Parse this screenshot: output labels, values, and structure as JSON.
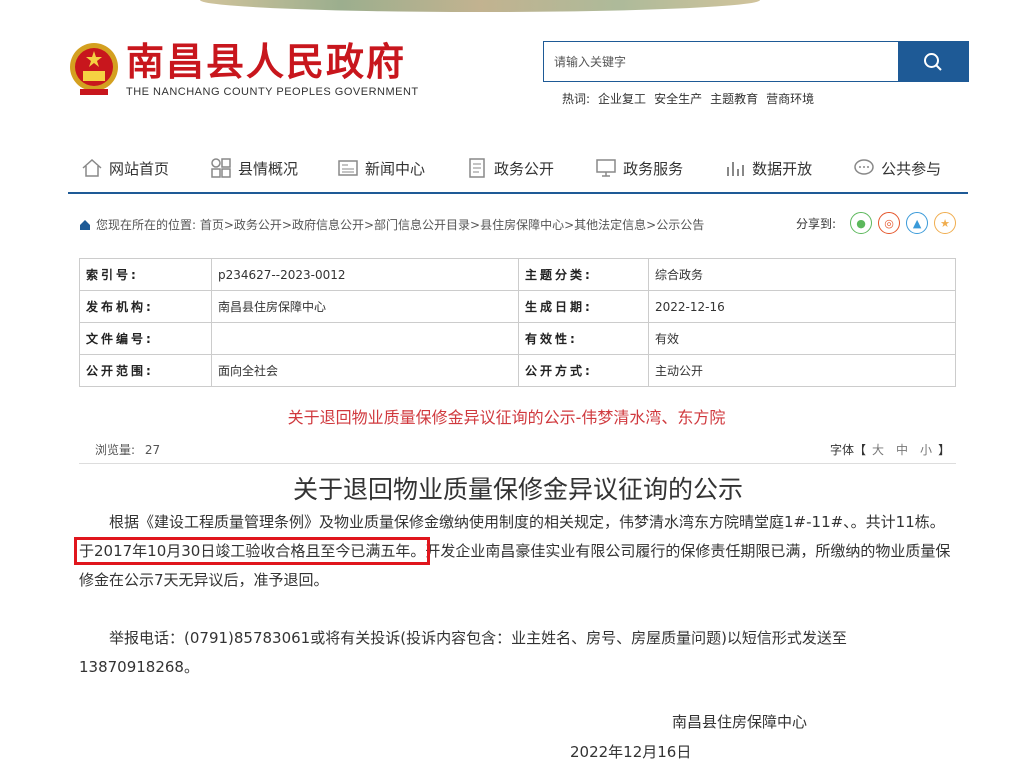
{
  "header": {
    "site_name_cn": "南昌县人民政府",
    "site_name_en": "THE NANCHANG COUNTY PEOPLES GOVERNMENT",
    "search_placeholder": "请输入关键字",
    "hot_label": "热词:",
    "hot_words": [
      "企业复工",
      "安全生产",
      "主题教育",
      "营商环境"
    ]
  },
  "nav": [
    {
      "label": "网站首页",
      "icon": "home-icon"
    },
    {
      "label": "县情概况",
      "icon": "grid-icon"
    },
    {
      "label": "新闻中心",
      "icon": "news-icon"
    },
    {
      "label": "政务公开",
      "icon": "document-icon"
    },
    {
      "label": "政务服务",
      "icon": "monitor-icon"
    },
    {
      "label": "数据开放",
      "icon": "bar-chart-icon"
    },
    {
      "label": "公共参与",
      "icon": "chat-icon"
    }
  ],
  "breadcrumb": "您现在所在的位置: 首页>政务公开>政府信息公开>部门信息公开目录>县住房保障中心>其他法定信息>公示公告",
  "share_label": "分享到:",
  "share_icons": [
    "wechat-icon",
    "weibo-icon",
    "qq-icon",
    "qzone-icon"
  ],
  "info": {
    "rows": [
      {
        "l1": "索引号:",
        "v1": "p234627--2023-0012",
        "l2": "主题分类:",
        "v2": "综合政务"
      },
      {
        "l1": "发布机构:",
        "v1": "南昌县住房保障中心",
        "l2": "生成日期:",
        "v2": "2022-12-16"
      },
      {
        "l1": "文件编号:",
        "v1": "",
        "l2": "有效性:",
        "v2": "有效"
      },
      {
        "l1": "公开范围:",
        "v1": "面向全社会",
        "l2": "公开方式:",
        "v2": "主动公开"
      }
    ]
  },
  "red_title": "关于退回物业质量保修金异议征询的公示-伟梦清水湾、东方院",
  "views_label": "浏览量:",
  "views_count": "27",
  "font_label": "字体【",
  "font_options": [
    "大",
    "中",
    "小"
  ],
  "font_close": "】",
  "article": {
    "title": "关于退回物业质量保修金异议征询的公示",
    "p1_a": "根据《建设工程质量管理条例》及物业质量保修金缴纳使用制度的相关规定，伟梦清水湾东方院晴堂庭1#-11#、。共计11栋。",
    "p1_highlight": "于2017年10月30日竣工验收合格且至今已满五年。",
    "p1_b": "开发企业南昌豪佳实业有限公司履行的保修责任期限已满，所缴纳的物业质量保修金在公示7天无异议后，准予退回。",
    "p2": "举报电话：(0791)85783061或将有关投诉(投诉内容包含：业主姓名、房号、房屋质量问题)以短信形式发送至13870918268。",
    "signature": "南昌县住房保障中心",
    "date": "2022年12月16日"
  },
  "colors": {
    "brand_red": "#c8161d",
    "brand_blue": "#1e5a96",
    "highlight": "#e0161d"
  }
}
